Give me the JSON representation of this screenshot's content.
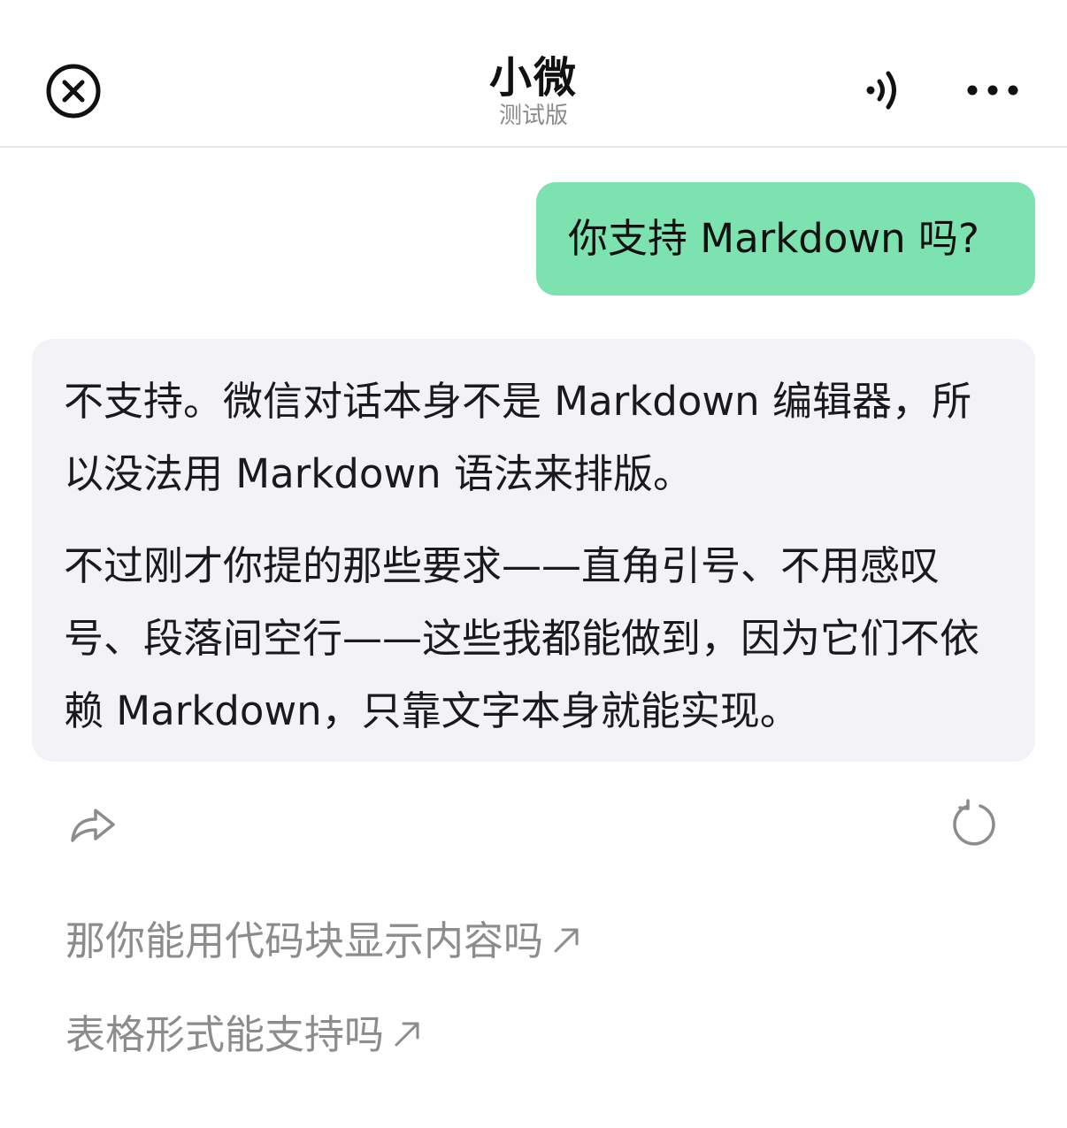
{
  "header": {
    "title": "小微",
    "subtitle": "测试版",
    "icons": {
      "close": "close-circle-icon",
      "sound": "speaker-icon",
      "more": "more-dots-icon"
    }
  },
  "conversation": {
    "user_message": "你支持 Markdown 吗?",
    "bot_message": {
      "paragraphs": [
        "不支持。微信对话本身不是 Markdown 编辑器，所以没法用 Markdown 语法来排版。",
        "不过刚才你提的那些要求——直角引号、不用感叹号、段落间空行——这些我都能做到，因为它们不依赖 Markdown，只靠文字本身就能实现。"
      ]
    },
    "actions": {
      "share": "share-icon",
      "regenerate": "refresh-icon"
    }
  },
  "suggestions": [
    "那你能用代码块显示内容吗",
    "表格形式能支持吗"
  ],
  "colors": {
    "user_bubble": "#7ce2b0",
    "bot_bubble": "#f3f2f7",
    "suggestion_text": "#8c8c8c"
  }
}
